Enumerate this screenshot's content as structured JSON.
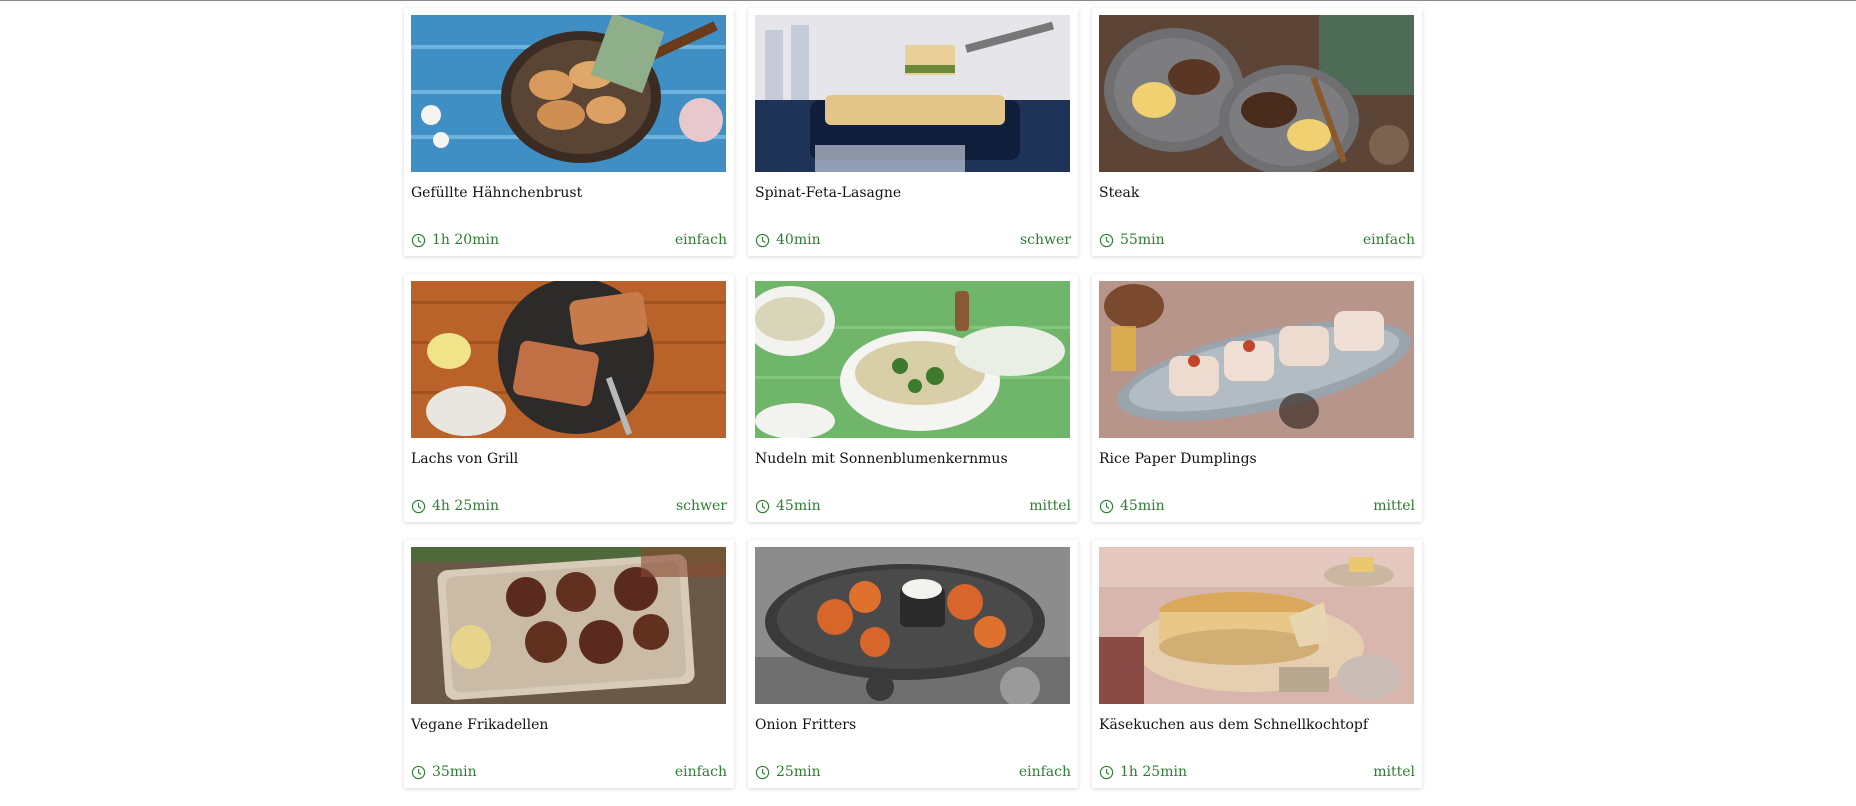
{
  "colors": {
    "accent": "#2e7d32",
    "title": "#111111",
    "card_bg": "#ffffff"
  },
  "recipes": [
    {
      "title": "Gefüllte Hähnchenbrust",
      "time": "1h 20min",
      "difficulty": "einfach",
      "image": "chicken-breast-pan-photo"
    },
    {
      "title": "Spinat-Feta-Lasagne",
      "time": "40min",
      "difficulty": "schwer",
      "image": "lasagne-dish-photo"
    },
    {
      "title": "Steak",
      "time": "55min",
      "difficulty": "einfach",
      "image": "steak-mushrooms-photo"
    },
    {
      "title": "Lachs von Grill",
      "time": "4h 25min",
      "difficulty": "schwer",
      "image": "grilled-salmon-photo"
    },
    {
      "title": "Nudeln mit Sonnenblumenkernmus",
      "time": "45min",
      "difficulty": "mittel",
      "image": "pasta-bowl-photo"
    },
    {
      "title": "Rice Paper Dumplings",
      "time": "45min",
      "difficulty": "mittel",
      "image": "dumplings-plate-photo"
    },
    {
      "title": "Vegane Frikadellen",
      "time": "35min",
      "difficulty": "einfach",
      "image": "vegan-patties-photo"
    },
    {
      "title": "Onion Fritters",
      "time": "25min",
      "difficulty": "einfach",
      "image": "onion-fritters-photo"
    },
    {
      "title": "Käsekuchen aus dem Schnellkochtopf",
      "time": "1h 25min",
      "difficulty": "mittel",
      "image": "cheesecake-photo"
    }
  ]
}
